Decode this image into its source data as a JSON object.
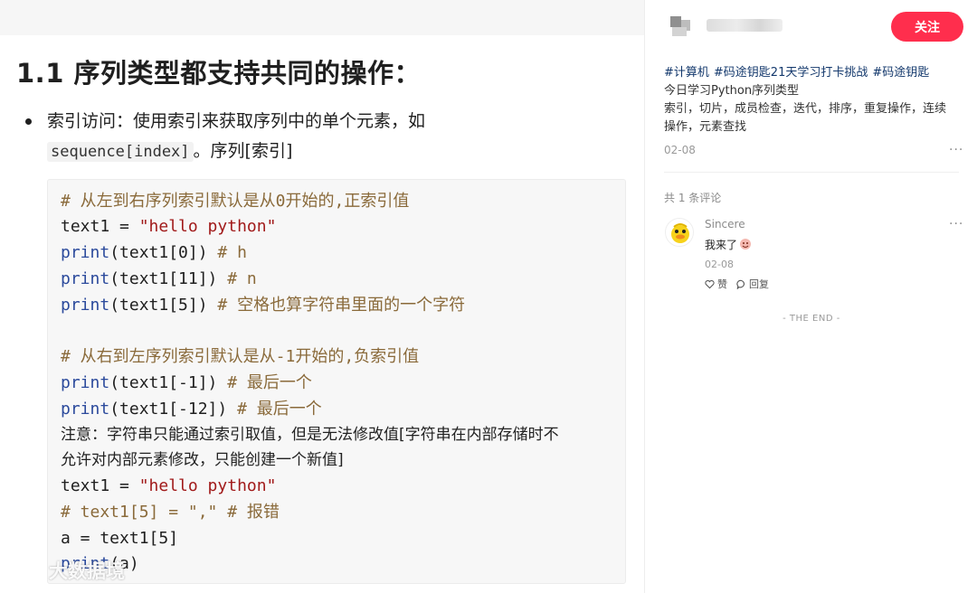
{
  "note": {
    "heading": "1.1 序列类型都支持共同的操作：",
    "bullet_text_1": "索引访问：使用索引来获取序列中的单个元素，如",
    "bullet_code": "sequence[index]",
    "bullet_text_2": "。序列[索引]",
    "code": {
      "l1": "# 从左到右序列索引默认是从0开始的,正索引值",
      "l2_var": "text1 = ",
      "l2_str": "\"hello python\"",
      "l3_fn": "print",
      "l3_args": "(text1[0])",
      "l3_cmt": "  # h",
      "l4_fn": "print",
      "l4_args": "(text1[11])",
      "l4_cmt": "  # n",
      "l5_fn": "print",
      "l5_args": "(text1[5])",
      "l5_cmt": "  # 空格也算字符串里面的一个字符",
      "l6": "#  从右到左序列索引默认是从-1开始的,负索引值",
      "l7_fn": "print",
      "l7_args": "(text1[-1])",
      "l7_cmt": "  # 最后一个",
      "l8_fn": "print",
      "l8_args": "(text1[-12])",
      "l8_cmt": "  # 最后一个",
      "note1": "注意：字符串只能通过索引取值，但是无法修改值[字符串在内部存储时不",
      "note2": "允许对内部元素修改，只能创建一个新值]",
      "l9_var": "text1 = ",
      "l9_str": "\"hello python\"",
      "l10": "# text1[5] = \",\" # 报错",
      "l11": "a = text1[5]",
      "l12_fn": "print",
      "l12_args": "(a)"
    },
    "watermark": "大数据境"
  },
  "side": {
    "follow_label": "关注",
    "tags": [
      "#计算机",
      "#码途钥匙21天学习打卡挑战",
      "#码途钥匙"
    ],
    "line1": "今日学习Python序列类型",
    "line2": "索引，切片，成员检查，迭代，排序，重复操作，连续",
    "line3": "操作，元素查找",
    "date": "02-08",
    "more": "···",
    "comment_count": "共 1 条评论",
    "comment": {
      "user": "Sincere",
      "text": "我来了",
      "date": "02-08",
      "like_label": "赞",
      "reply_label": "回复"
    },
    "the_end": "- THE END -"
  },
  "colors": {
    "follow_bg": "#ff2e4d",
    "tag_text": "#13386c",
    "code_bg": "#f7f7f7",
    "comment_color": "#8a6a3a",
    "string_color": "#a11a1a"
  },
  "icons": [
    "more-icon",
    "heart-icon",
    "comment-icon",
    "duck-avatar-icon",
    "emoji-icon",
    "watermark-logo-icon"
  ]
}
